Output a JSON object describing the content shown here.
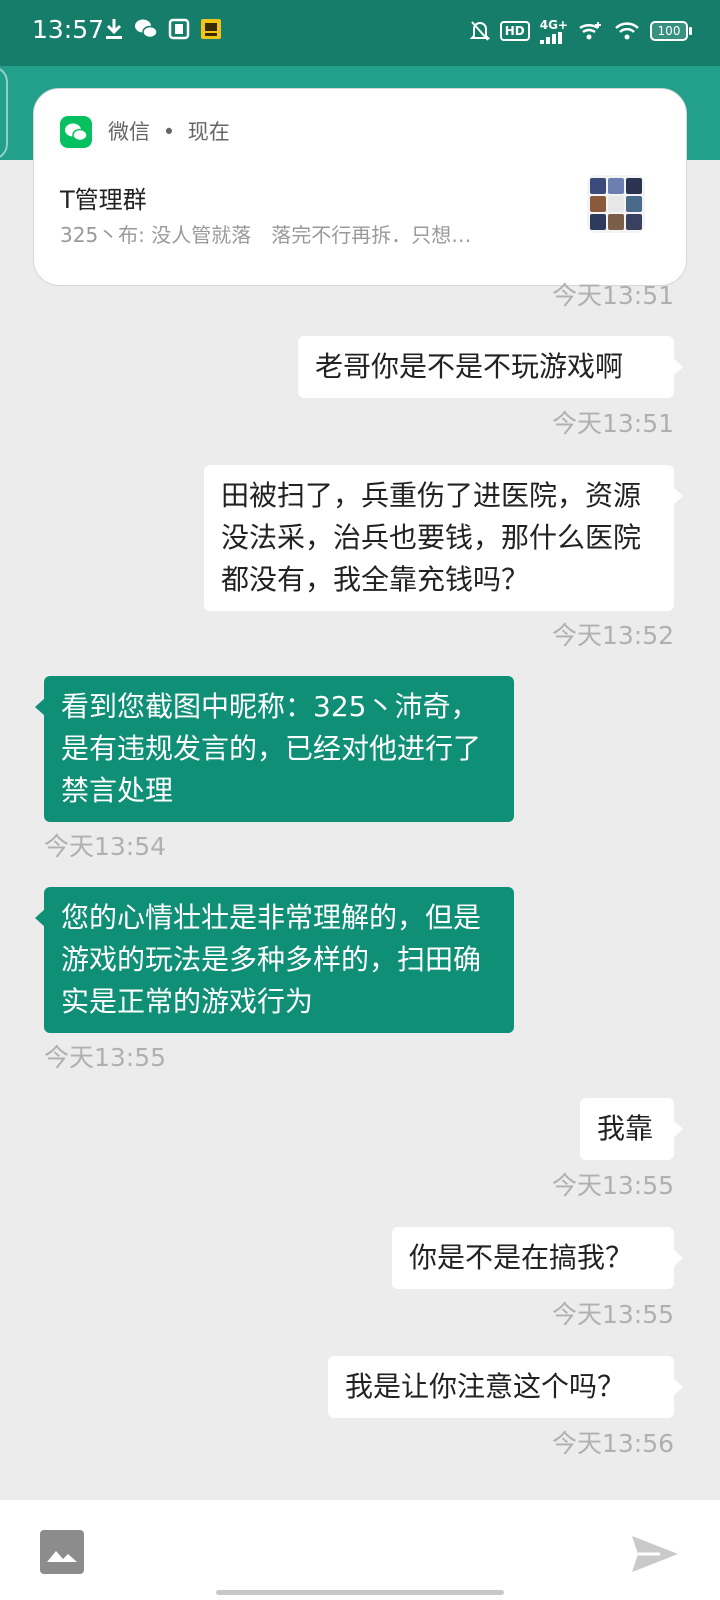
{
  "status_bar": {
    "time": "13:57",
    "left_icons": [
      "download-icon",
      "wechat-icon",
      "app-icon",
      "app-badge-icon"
    ],
    "hd_label": "HD",
    "network_label": "4G+",
    "battery": "100",
    "right_icons": [
      "bell-off-icon",
      "hd-icon",
      "signal-icon",
      "signal-plus-icon",
      "wifi-icon",
      "battery-icon"
    ]
  },
  "notification": {
    "app_name": "微信",
    "separator": "•",
    "time": "现在",
    "title": "T管理群",
    "body": "325丶布: 没人管就落　落完不行再拆．只想…"
  },
  "messages": [
    {
      "type": "timestamp",
      "side": "right",
      "text": "今天13:51"
    },
    {
      "type": "bubble",
      "side": "right",
      "text": "老哥你是不是不玩游戏啊"
    },
    {
      "type": "timestamp",
      "side": "right",
      "text": "今天13:51"
    },
    {
      "type": "bubble",
      "side": "right",
      "text": "田被扫了，兵重伤了进医院，资源没法采，治兵也要钱，那什么医院都没有，我全靠充钱吗？"
    },
    {
      "type": "timestamp",
      "side": "right",
      "text": "今天13:52"
    },
    {
      "type": "bubble",
      "side": "left",
      "text": "看到您截图中昵称：325丶沛奇，是有违规发言的，已经对他进行了禁言处理"
    },
    {
      "type": "timestamp",
      "side": "left",
      "text": "今天13:54"
    },
    {
      "type": "bubble",
      "side": "left",
      "text": "您的心情壮壮是非常理解的，但是游戏的玩法是多种多样的，扫田确实是正常的游戏行为"
    },
    {
      "type": "timestamp",
      "side": "left",
      "text": "今天13:55"
    },
    {
      "type": "bubble",
      "side": "right",
      "text": "我靠"
    },
    {
      "type": "timestamp",
      "side": "right",
      "text": "今天13:55"
    },
    {
      "type": "bubble",
      "side": "right",
      "text": "你是不是在搞我？"
    },
    {
      "type": "timestamp",
      "side": "right",
      "text": "今天13:55"
    },
    {
      "type": "bubble",
      "side": "right",
      "text": "我是让你注意这个吗？"
    },
    {
      "type": "timestamp",
      "side": "right",
      "text": "今天13:56"
    }
  ],
  "input_bar": {
    "value": "",
    "placeholder": "",
    "image_icon": "image-icon",
    "send_icon": "send-icon"
  },
  "colors": {
    "status_bar": "#167d6b",
    "header": "#23a08b",
    "incoming_bubble": "#0f8f76",
    "outgoing_bubble": "#ffffff",
    "chat_background": "#ececec",
    "wechat_green": "#07c160"
  }
}
